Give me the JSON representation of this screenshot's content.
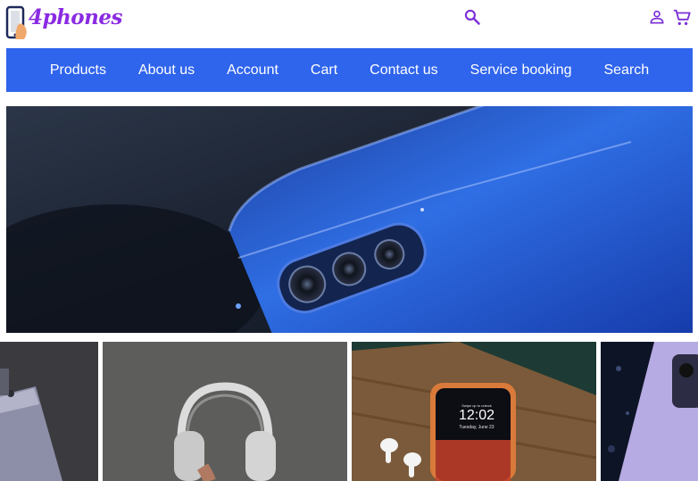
{
  "brand": {
    "logo_text": "4phones",
    "accent": "#8a2be2"
  },
  "header": {
    "search_icon": "search-icon",
    "account_icon": "account-icon",
    "cart_icon": "cart-icon"
  },
  "nav": {
    "background": "#2f64ec",
    "items": [
      "Products",
      "About us",
      "Account",
      "Cart",
      "Contact us",
      "Service booking",
      "Search"
    ]
  },
  "hero": {
    "image": "blue-phone-camera-closeup"
  },
  "tiles": [
    {
      "image": "silver-phone-partial"
    },
    {
      "image": "silver-headphones"
    },
    {
      "image": "phone-lockscreen-with-earbuds"
    },
    {
      "image": "purple-phone-partial"
    }
  ],
  "lockscreen": {
    "unlock_text": "Swipe up to unlock",
    "time": "12:02",
    "date": "Tuesday, June 23"
  }
}
